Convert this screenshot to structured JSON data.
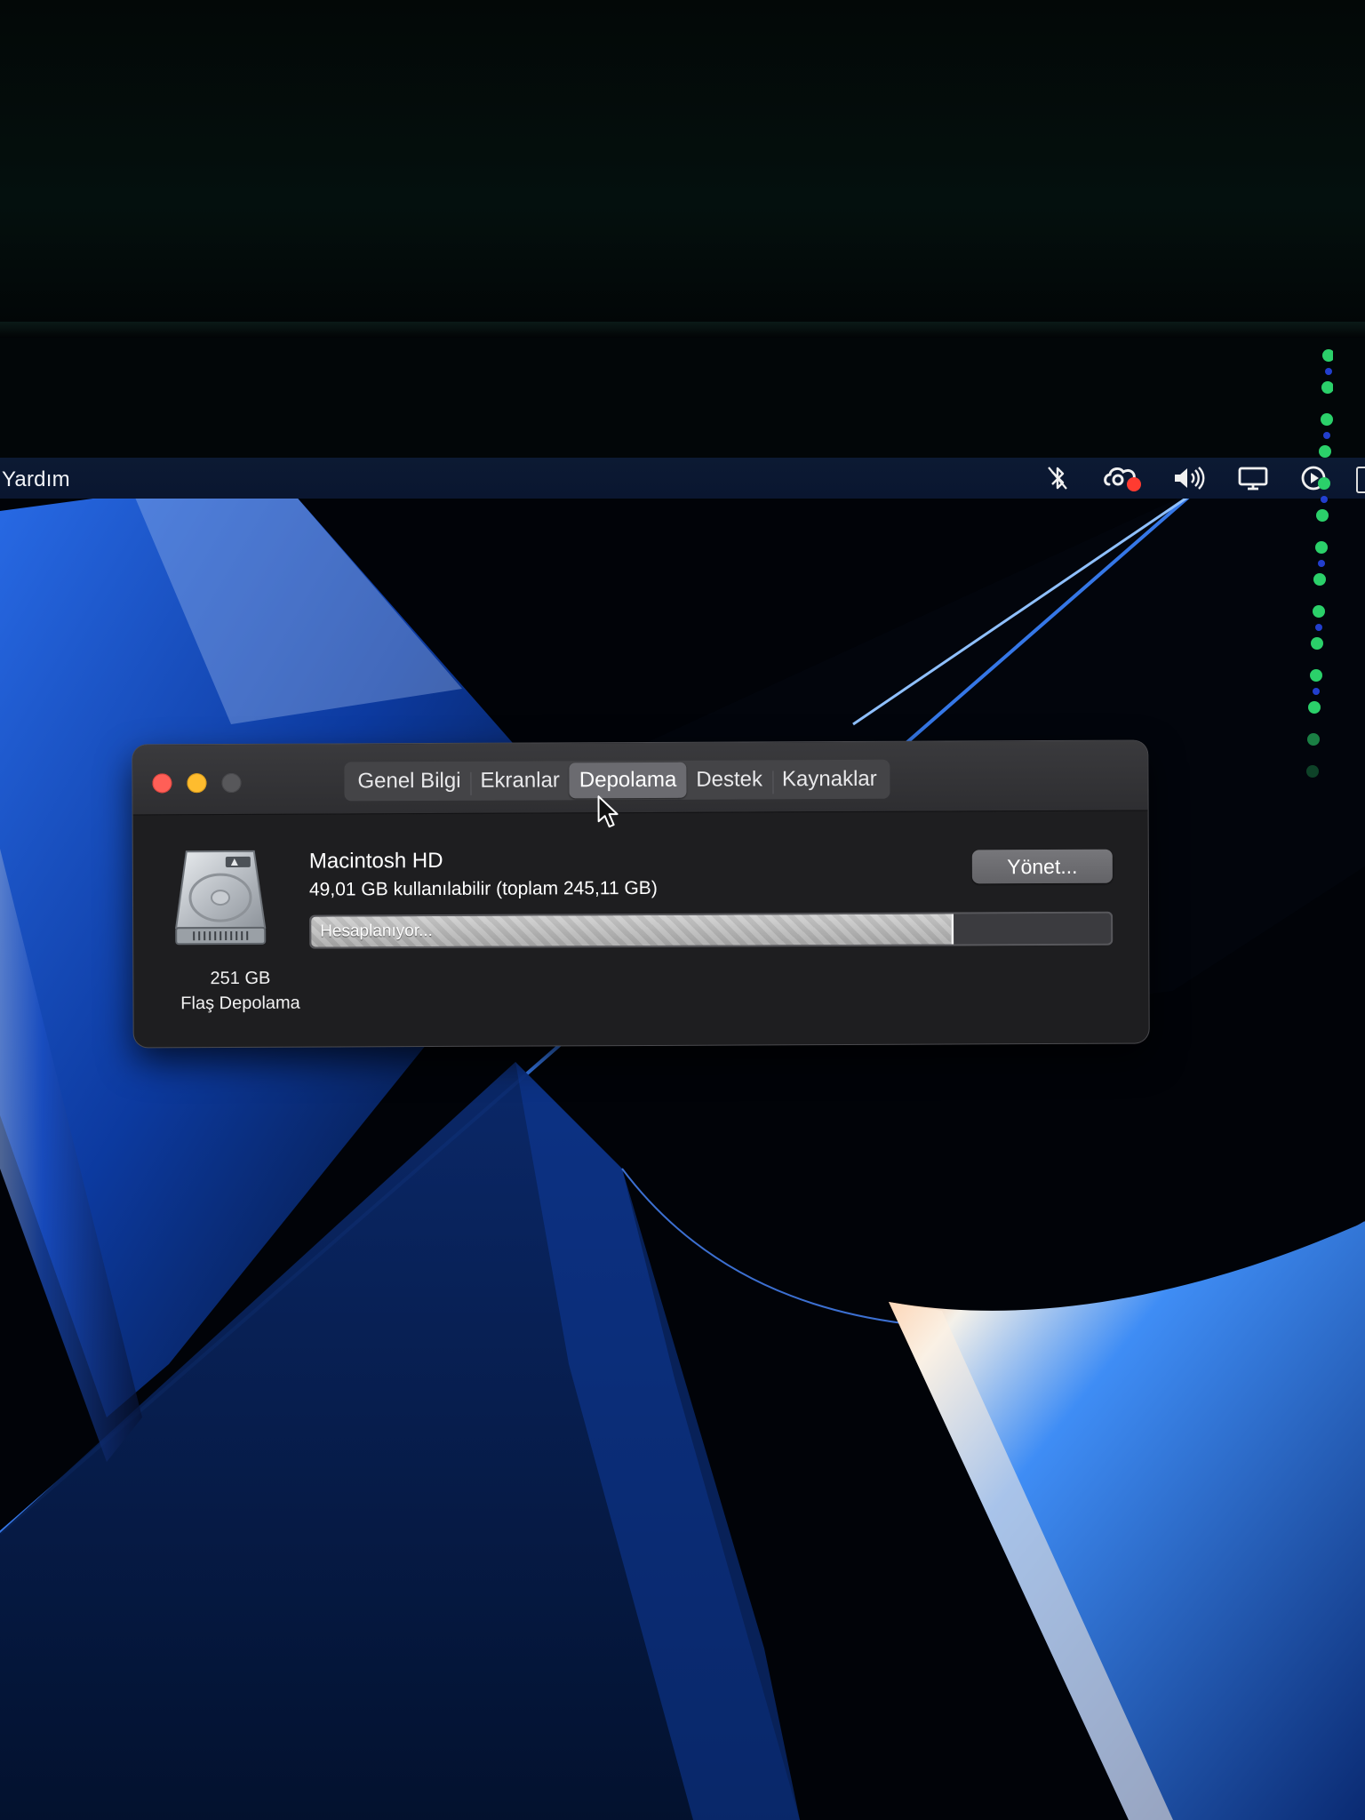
{
  "menubar": {
    "help_label": "Yardım",
    "status_icons": [
      "bluetooth-off-icon",
      "creative-cloud-icon",
      "volume-icon",
      "display-icon",
      "play-circle-icon"
    ]
  },
  "window": {
    "tabs": [
      {
        "label": "Genel Bilgi",
        "active": false
      },
      {
        "label": "Ekranlar",
        "active": false
      },
      {
        "label": "Depolama",
        "active": true
      },
      {
        "label": "Destek",
        "active": false
      },
      {
        "label": "Kaynaklar",
        "active": false
      }
    ],
    "disk": {
      "size_label": "251 GB",
      "type_label": "Flaş Depolama",
      "icon": "hard-drive-icon"
    },
    "volume": {
      "name": "Macintosh HD",
      "availability": "49,01 GB kullanılabilir (toplam 245,11 GB)",
      "status_label": "Hesaplanıyor...",
      "used_fraction": 0.8
    },
    "manage_label": "Yönet..."
  },
  "colors": {
    "close": "#ff5f57",
    "minimize": "#febc2e",
    "zoom_disabled": "#57575a",
    "menubar": "#0c1a33",
    "wallpaper_accent": "#1a5fd6"
  }
}
